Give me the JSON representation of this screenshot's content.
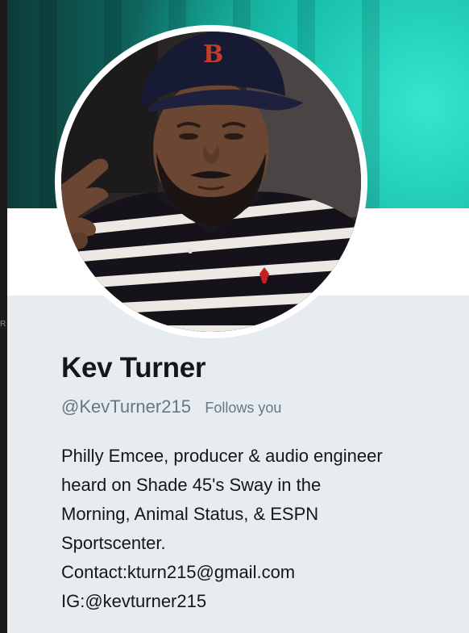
{
  "profile": {
    "display_name": "Kev Turner",
    "handle": "@KevTurner215",
    "follows_you_label": "Follows you",
    "bio_lines": [
      "Philly Emcee, producer & audio engineer",
      "heard on Shade 45's Sway in the",
      "Morning, Animal Status, & ESPN",
      "Sportscenter.",
      "Contact:kturn215@gmail.com",
      "IG:@kevturner215"
    ],
    "avatar_cap_logo": "B"
  },
  "edge_char": "R",
  "colors": {
    "banner_teal": "#19c0ad",
    "card_background": "#e6ecf0",
    "name_text": "#14171a",
    "muted_text": "#657786"
  }
}
